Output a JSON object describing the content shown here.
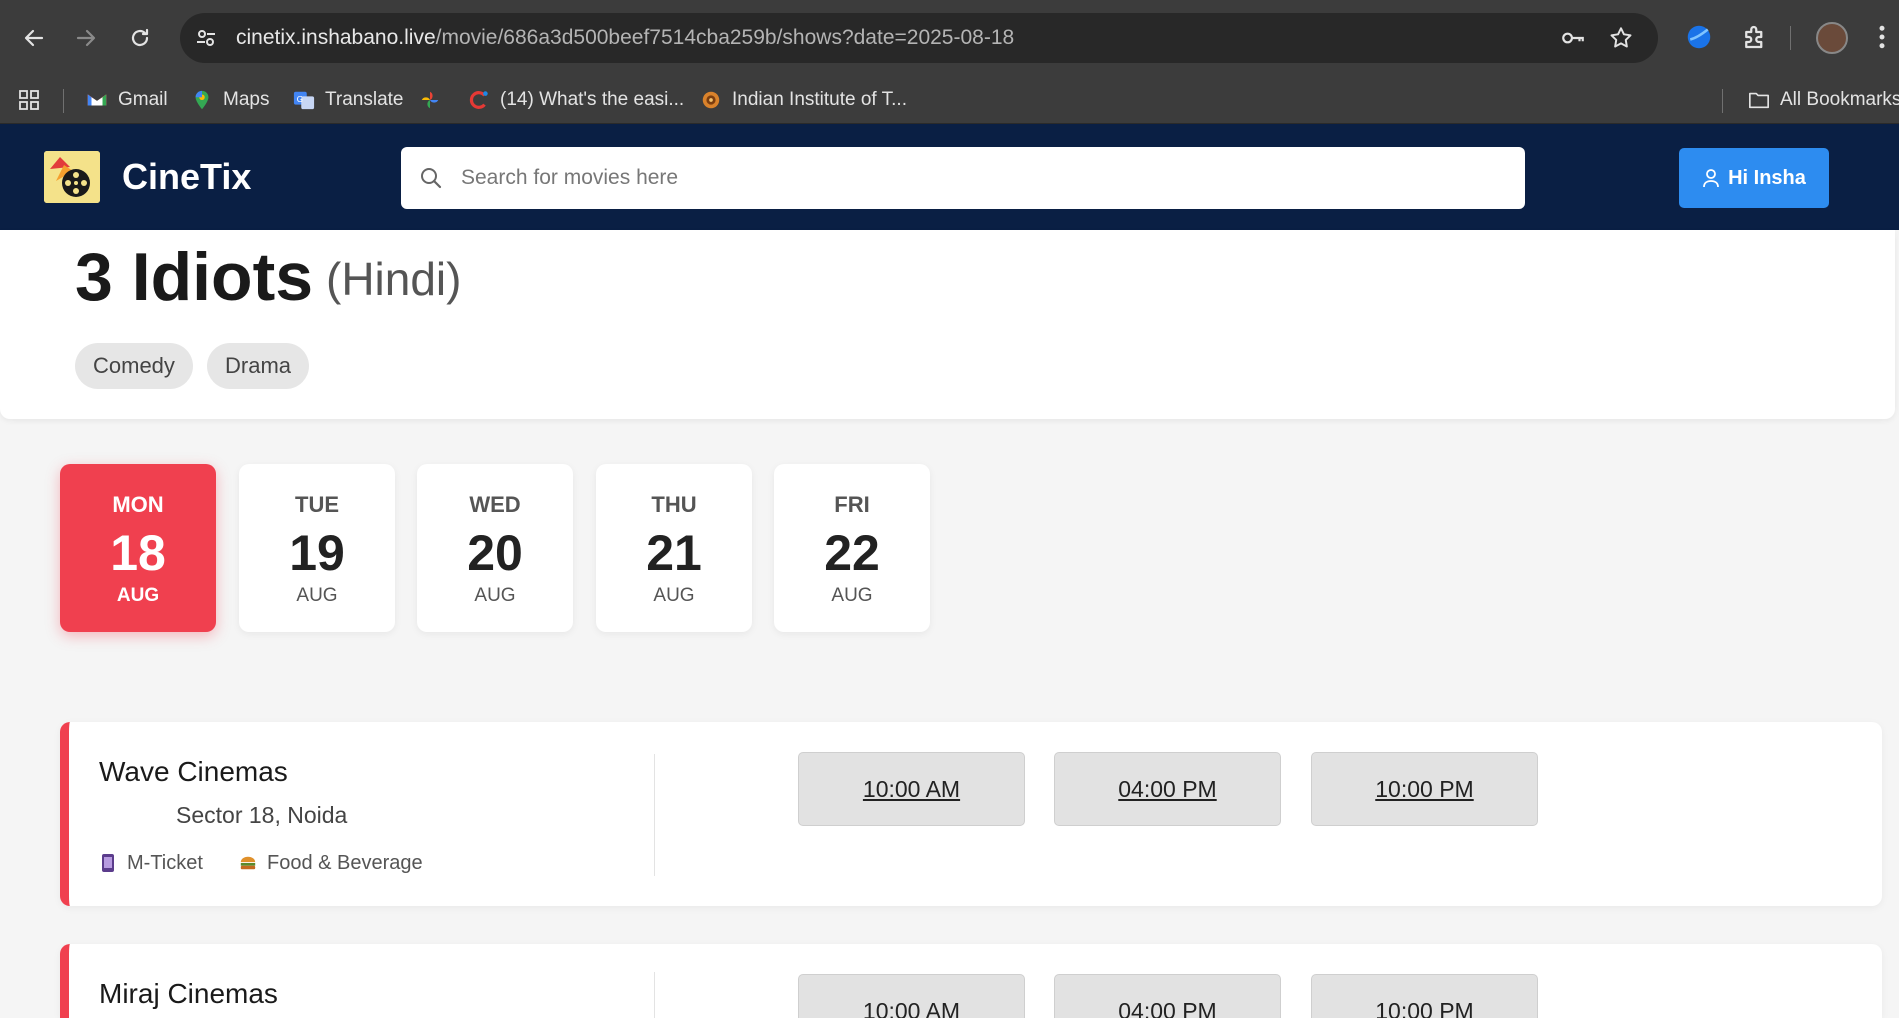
{
  "browser": {
    "url_host": "cinetix.inshabano.live",
    "url_path": "/movie/686a3d500beef7514cba259b/shows?date=2025-08-18",
    "bookmarks": [
      {
        "label": "Gmail"
      },
      {
        "label": "Maps"
      },
      {
        "label": "Translate"
      },
      {
        "label": ""
      },
      {
        "label": "(14) What's the easi..."
      },
      {
        "label": "Indian Institute of T..."
      }
    ],
    "all_bookmarks": "All Bookmarks"
  },
  "header": {
    "brand": "CineTix",
    "search_placeholder": "Search for movies here",
    "user_label": "Hi Insha",
    "bg_color": "#0a1f44",
    "accent_color": "#2d8cf0"
  },
  "movie": {
    "title": "3 Idiots",
    "language": "(Hindi)",
    "genres": [
      "Comedy",
      "Drama"
    ]
  },
  "dates": [
    {
      "day": "MON",
      "num": "18",
      "month": "AUG",
      "selected": true
    },
    {
      "day": "TUE",
      "num": "19",
      "month": "AUG",
      "selected": false
    },
    {
      "day": "WED",
      "num": "20",
      "month": "AUG",
      "selected": false
    },
    {
      "day": "THU",
      "num": "21",
      "month": "AUG",
      "selected": false
    },
    {
      "day": "FRI",
      "num": "22",
      "month": "AUG",
      "selected": false
    }
  ],
  "theatres": [
    {
      "name": "Wave Cinemas",
      "location": "Sector 18, Noida",
      "features": [
        "M-Ticket",
        "Food & Beverage"
      ],
      "showtimes": [
        "10:00 AM",
        "04:00 PM",
        "10:00 PM"
      ]
    },
    {
      "name": "Miraj Cinemas",
      "location": "",
      "features": [],
      "showtimes": [
        "10:00 AM",
        "04:00 PM",
        "10:00 PM"
      ]
    }
  ],
  "colors": {
    "selected_date": "#f0404f",
    "theatre_accent": "#f0404f"
  }
}
